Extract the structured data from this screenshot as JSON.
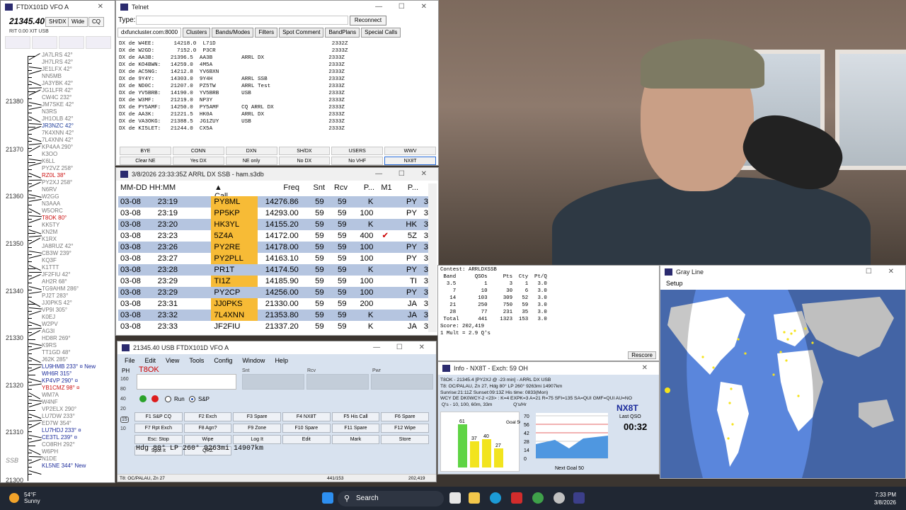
{
  "bandmap": {
    "title": "FTDX101D VFO A",
    "freq": "21345.40",
    "btn_shdx": "SH/DX",
    "btn_wide": "Wide",
    "btn_cq": "CQ",
    "rit": "RIT  0.00  XIT  USB",
    "freq_labels": [
      "21380",
      "21370",
      "21360",
      "21350",
      "21340",
      "21330",
      "21320",
      "21310",
      "SSB",
      "21300"
    ],
    "spots": [
      {
        "t": "JA7LRS 42°",
        "c": "gray"
      },
      {
        "t": "JH7LRS 42°",
        "c": "gray"
      },
      {
        "t": "JE1LFX 42°",
        "c": "gray"
      },
      {
        "t": "NN5MB",
        "c": "gray"
      },
      {
        "t": "JA3YBK 42°",
        "c": "gray"
      },
      {
        "t": "JG1LFR 42°",
        "c": "gray"
      },
      {
        "t": "CW4C 232°",
        "c": "gray"
      },
      {
        "t": "JM7SKE 42°",
        "c": "gray"
      },
      {
        "t": "N3RS",
        "c": "gray"
      },
      {
        "t": "JH1OLB 42°",
        "c": "gray"
      },
      {
        "t": "JR3NZC 42°",
        "c": "blue"
      },
      {
        "t": "7K4XNN 42°",
        "c": "gray"
      },
      {
        "t": "7L4XNN 42°",
        "c": "gray"
      },
      {
        "t": "KP4AA 290°",
        "c": "gray"
      },
      {
        "t": "K3OO",
        "c": "gray"
      },
      {
        "t": "K6LL",
        "c": "gray"
      },
      {
        "t": "PY2VZ 258°",
        "c": "gray"
      },
      {
        "t": "RZ0L 38°",
        "c": "red"
      },
      {
        "t": "PY2XJ 258°",
        "c": "gray"
      },
      {
        "t": "N6RV",
        "c": "gray"
      },
      {
        "t": "W2GG",
        "c": "gray"
      },
      {
        "t": "N3AAA",
        "c": "gray"
      },
      {
        "t": "W5ORC",
        "c": "gray"
      },
      {
        "t": "T8OK 80°",
        "c": "red"
      },
      {
        "t": "KK5TY",
        "c": "gray"
      },
      {
        "t": "KN2M",
        "c": "gray"
      },
      {
        "t": "K1RX",
        "c": "gray"
      },
      {
        "t": "JA8RUZ 42°",
        "c": "gray"
      },
      {
        "t": "CB3W 239°",
        "c": "gray"
      },
      {
        "t": "KQ3F",
        "c": "gray"
      },
      {
        "t": "K1TTT",
        "c": "gray"
      },
      {
        "t": "JF2FIU 42°",
        "c": "gray"
      },
      {
        "t": "AH2R 68°",
        "c": "gray"
      },
      {
        "t": "TG9AHM 286°",
        "c": "gray"
      },
      {
        "t": "PJ2T 283°",
        "c": "gray"
      },
      {
        "t": "JJ0PKS 42°",
        "c": "gray"
      },
      {
        "t": "VP9I 305°",
        "c": "gray"
      },
      {
        "t": "K0EJ",
        "c": "gray"
      },
      {
        "t": "W2PV",
        "c": "gray"
      },
      {
        "t": "AG3I",
        "c": "gray"
      },
      {
        "t": "HD8R 269°",
        "c": "gray"
      },
      {
        "t": "K9RS",
        "c": "gray"
      },
      {
        "t": "TT1GD 48°",
        "c": "gray"
      },
      {
        "t": "J62K 285°",
        "c": "gray"
      },
      {
        "t": "LU9HMB 233° ¤ New",
        "c": "navy"
      },
      {
        "t": "WH6R 315°",
        "c": "navy"
      },
      {
        "t": "KP4VP 290° ¤",
        "c": "navy"
      },
      {
        "t": "YB1CMZ 98° ¤",
        "c": "red"
      },
      {
        "t": "WM7A",
        "c": "gray"
      },
      {
        "t": "W4NF",
        "c": "gray"
      },
      {
        "t": "VP2ELX 290°",
        "c": "gray"
      },
      {
        "t": "LU7DW 233°",
        "c": "gray"
      },
      {
        "t": "ED7W 354°",
        "c": "gray"
      },
      {
        "t": "LU7HDJ 233° ¤",
        "c": "navy"
      },
      {
        "t": "CE3TL 239° ¤",
        "c": "navy"
      },
      {
        "t": "CO8RH 292°",
        "c": "gray"
      },
      {
        "t": "W6PH",
        "c": "gray"
      },
      {
        "t": "N1DE",
        "c": "gray"
      },
      {
        "t": "KL5NE 344° New",
        "c": "navy"
      }
    ]
  },
  "telnet": {
    "title": "Telnet",
    "type_label": "Type:",
    "reconnect": "Reconnect",
    "tabs": [
      "dxfuncluster.com:8000",
      "Clusters",
      "Bands/Modes",
      "Filters",
      "Spot Comment",
      "BandPlans",
      "Special Calls"
    ],
    "lines": [
      "DX de W4EE:      14218.0  L71D                                    2332Z",
      "DX de W2GD:       7152.0  P3CR                                    2333Z",
      "DX de AA3B:     21396.5  AA3B         ARRL DX                    2333Z",
      "DX de KO4BWN:   14259.0  4M5A                                    2333Z",
      "DX de AC5NG:    14212.8  YV6BXN                                  2333Z",
      "DX de 9Y4Y:     14303.0  9Y4H         ARRL SSB                   2333Z",
      "DX de ND0C:     21207.0  PZ5TW        ARRL Test                  2333Z",
      "DX de YV5BRB:   14190.0  YV5BRB       USB                        2333Z",
      "DX de W3MF:     21219.0  NP3Y                                    2333Z",
      "DX de PY5AMF:   14250.0  PY5AMF       CQ ARRL DX                 2333Z",
      "DX de AA3K:     21221.5  HK0A         ARRL DX                    2333Z",
      "DX de VA3OKG:   21388.5  JG1ZUY       USB                        2333Z",
      "DX de KI5LET:   21244.0  CX5A                                    2333Z"
    ],
    "buttons": [
      "BYE",
      "CONN",
      "DXN",
      "SH/DX",
      "USERS",
      "WWV",
      "Clear NE",
      "Yes DX",
      "NE only",
      "No DX",
      "No VHF",
      "NX8T"
    ]
  },
  "log": {
    "title": "3/8/2026 23:33:35Z  ARRL DX SSB - ham.s3db",
    "headers": [
      "MM-DD HH:MM",
      "Call",
      "Freq",
      "Snt",
      "Rcv",
      "P...",
      "M1",
      "P..."
    ],
    "rows": [
      {
        "d": "03-08",
        "t": "23:19",
        "call": "PY8ML",
        "f": "14276.86",
        "s": "59",
        "r": "59",
        "p": "K",
        "m": "",
        "x": "PY",
        "c": "3",
        "hl": true
      },
      {
        "d": "03-08",
        "t": "23:19",
        "call": "PP5KP",
        "f": "14293.00",
        "s": "59",
        "r": "59",
        "p": "100",
        "m": "",
        "x": "PY",
        "c": "3",
        "hl": true
      },
      {
        "d": "03-08",
        "t": "23:20",
        "call": "HK3YL",
        "f": "14155.20",
        "s": "59",
        "r": "59",
        "p": "K",
        "m": "",
        "x": "HK",
        "c": "3",
        "hl": true
      },
      {
        "d": "03-08",
        "t": "23:23",
        "call": "5Z4A",
        "f": "14172.00",
        "s": "59",
        "r": "59",
        "p": "400",
        "m": "✔",
        "x": "5Z",
        "c": "3",
        "hl": true
      },
      {
        "d": "03-08",
        "t": "23:26",
        "call": "PY2RE",
        "f": "14178.00",
        "s": "59",
        "r": "59",
        "p": "100",
        "m": "",
        "x": "PY",
        "c": "3",
        "hl": true
      },
      {
        "d": "03-08",
        "t": "23:27",
        "call": "PY2PLL",
        "f": "14163.10",
        "s": "59",
        "r": "59",
        "p": "100",
        "m": "",
        "x": "PY",
        "c": "3",
        "hl": true
      },
      {
        "d": "03-08",
        "t": "23:28",
        "call": "PR1T",
        "f": "14174.50",
        "s": "59",
        "r": "59",
        "p": "K",
        "m": "",
        "x": "PY",
        "c": "3",
        "hl": false
      },
      {
        "d": "03-08",
        "t": "23:29",
        "call": "TI1Z",
        "f": "14185.90",
        "s": "59",
        "r": "59",
        "p": "100",
        "m": "",
        "x": "TI",
        "c": "3",
        "hl": true
      },
      {
        "d": "03-08",
        "t": "23:29",
        "call": "PY2CP",
        "f": "14256.00",
        "s": "59",
        "r": "59",
        "p": "100",
        "m": "",
        "x": "PY",
        "c": "3",
        "hl": false
      },
      {
        "d": "03-08",
        "t": "23:31",
        "call": "JJ0PKS",
        "f": "21330.00",
        "s": "59",
        "r": "59",
        "p": "200",
        "m": "",
        "x": "JA",
        "c": "3",
        "hl": true
      },
      {
        "d": "03-08",
        "t": "23:32",
        "call": "7L4XNN",
        "f": "21353.80",
        "s": "59",
        "r": "59",
        "p": "K",
        "m": "",
        "x": "JA",
        "c": "3",
        "hl": true
      },
      {
        "d": "03-08",
        "t": "23:33",
        "call": "JF2FIU",
        "f": "21337.20",
        "s": "59",
        "r": "59",
        "p": "K",
        "m": "",
        "x": "JA",
        "c": "3",
        "hl": false
      }
    ]
  },
  "entry": {
    "title": "21345.40 USB FTDX101D VFO A",
    "menu": [
      "File",
      "Edit",
      "View",
      "Tools",
      "Config",
      "Window",
      "Help"
    ],
    "ph": "PH",
    "call": "T8OK",
    "snt": "Snt",
    "rcv": "Rcv",
    "pwr": "Pwr",
    "side": [
      "160",
      "80",
      "40",
      "20",
      "15",
      "10"
    ],
    "run": "Run",
    "sp": "S&P",
    "fkeys": [
      "F1 S&P CQ",
      "F2 Exch",
      "F3 Spare",
      "F4 NX8T",
      "F5 His Call",
      "F6 Spare",
      "F7 Rpt Exch",
      "F8 Agn?",
      "F9 Zone",
      "F10 Spare",
      "F11 Spare",
      "F12 Wipe",
      "Esc: Stop",
      "Wipe",
      "Log It",
      "Edit",
      "Mark",
      "Store",
      "Spot It",
      "QRZ"
    ],
    "heading": "Hdg 80°  LP 260°  9263mi 14907km",
    "status_left": "T8: OC/PALAU, Zn 27",
    "status_mid": "441/153",
    "status_right": "202,419"
  },
  "summary": {
    "text": "Contest: ARRLDXSSB\n Band      QSOs     Pts  Cty  Pt/Q\n  3.5         1       3    1   3.0\n    7        10      30    6   3.0\n   14       103     309   52   3.0\n   21       250     750   59   3.0\n   28        77     231   35   3.0\n Total      441    1323  153   3.0\nScore: 202,419\n1 Mult = 2.9 Q's",
    "rescore": "Rescore"
  },
  "info": {
    "title": "Info - NX8T - Exch: 59 OH",
    "text": "T8OK - 21345.4 [PY2XJ @ -23 min] - ARRL DX USB\nT8: OC/PALAU, Zn 27, Hdg 80° LP 260° 9263mi 14907km\nSunrise:21:11Z Sunset:09:13Z His time: 0833(Mon)\nWCY DE DK0WCY-2 <23> : K=4 EXPK=3 A=21 R=75 SFI=135 SA=QUI GMF=QUI AU=NO\n Q's - 10, 100, 60m, 33m                Q's/Hr",
    "bars": [
      {
        "label": "61",
        "v": 61
      },
      {
        "label": "37",
        "v": 37
      },
      {
        "label": "40",
        "v": 40
      },
      {
        "label": "27",
        "v": 27
      }
    ],
    "goal": "Goal 50",
    "rate_ticks": [
      "70",
      "56",
      "42",
      "28",
      "14",
      "0"
    ],
    "next_goal": "Next Goal 50",
    "call": "NX8T",
    "last_qso": "Last QSO",
    "timer": "00:32"
  },
  "grayline": {
    "title": "Gray Line",
    "setup": "Setup"
  },
  "taskbar": {
    "temp": "54°F",
    "weather": "Sunny",
    "search": "Search",
    "time": "7:33 PM",
    "date": "3/8/2026"
  },
  "colors": {
    "accent": "#1b3a99",
    "highlight": "#f7bb36",
    "row_alt": "#b5c5e0",
    "entry_bg": "#d8e2ef"
  }
}
